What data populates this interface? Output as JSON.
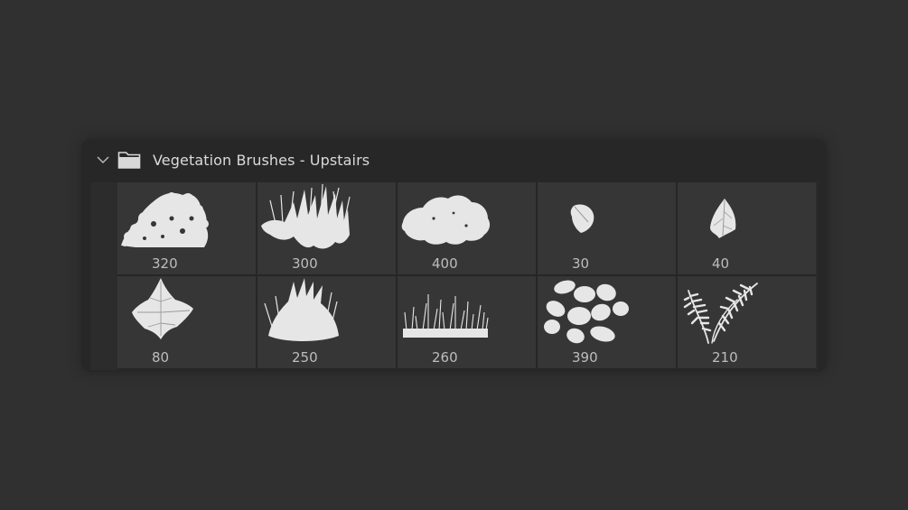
{
  "panel": {
    "title": "Vegetation Brushes - Upstairs",
    "icons": {
      "expand": "chevron-down-icon",
      "folder": "folder-icon"
    }
  },
  "brushes": [
    {
      "size": "320",
      "kind": "bush-spray"
    },
    {
      "size": "300",
      "kind": "grass-reeds"
    },
    {
      "size": "400",
      "kind": "hedge-blob"
    },
    {
      "size": "30",
      "kind": "small-leaf"
    },
    {
      "size": "40",
      "kind": "arrow-leaf"
    },
    {
      "size": "80",
      "kind": "ivy-leaf"
    },
    {
      "size": "250",
      "kind": "grass-tuft"
    },
    {
      "size": "260",
      "kind": "weeds-strip"
    },
    {
      "size": "390",
      "kind": "leaf-cluster"
    },
    {
      "size": "210",
      "kind": "fern"
    }
  ],
  "colors": {
    "background": "#303030",
    "panel": "#272727",
    "tile": "#363636",
    "brush": "#e8e8e8"
  }
}
